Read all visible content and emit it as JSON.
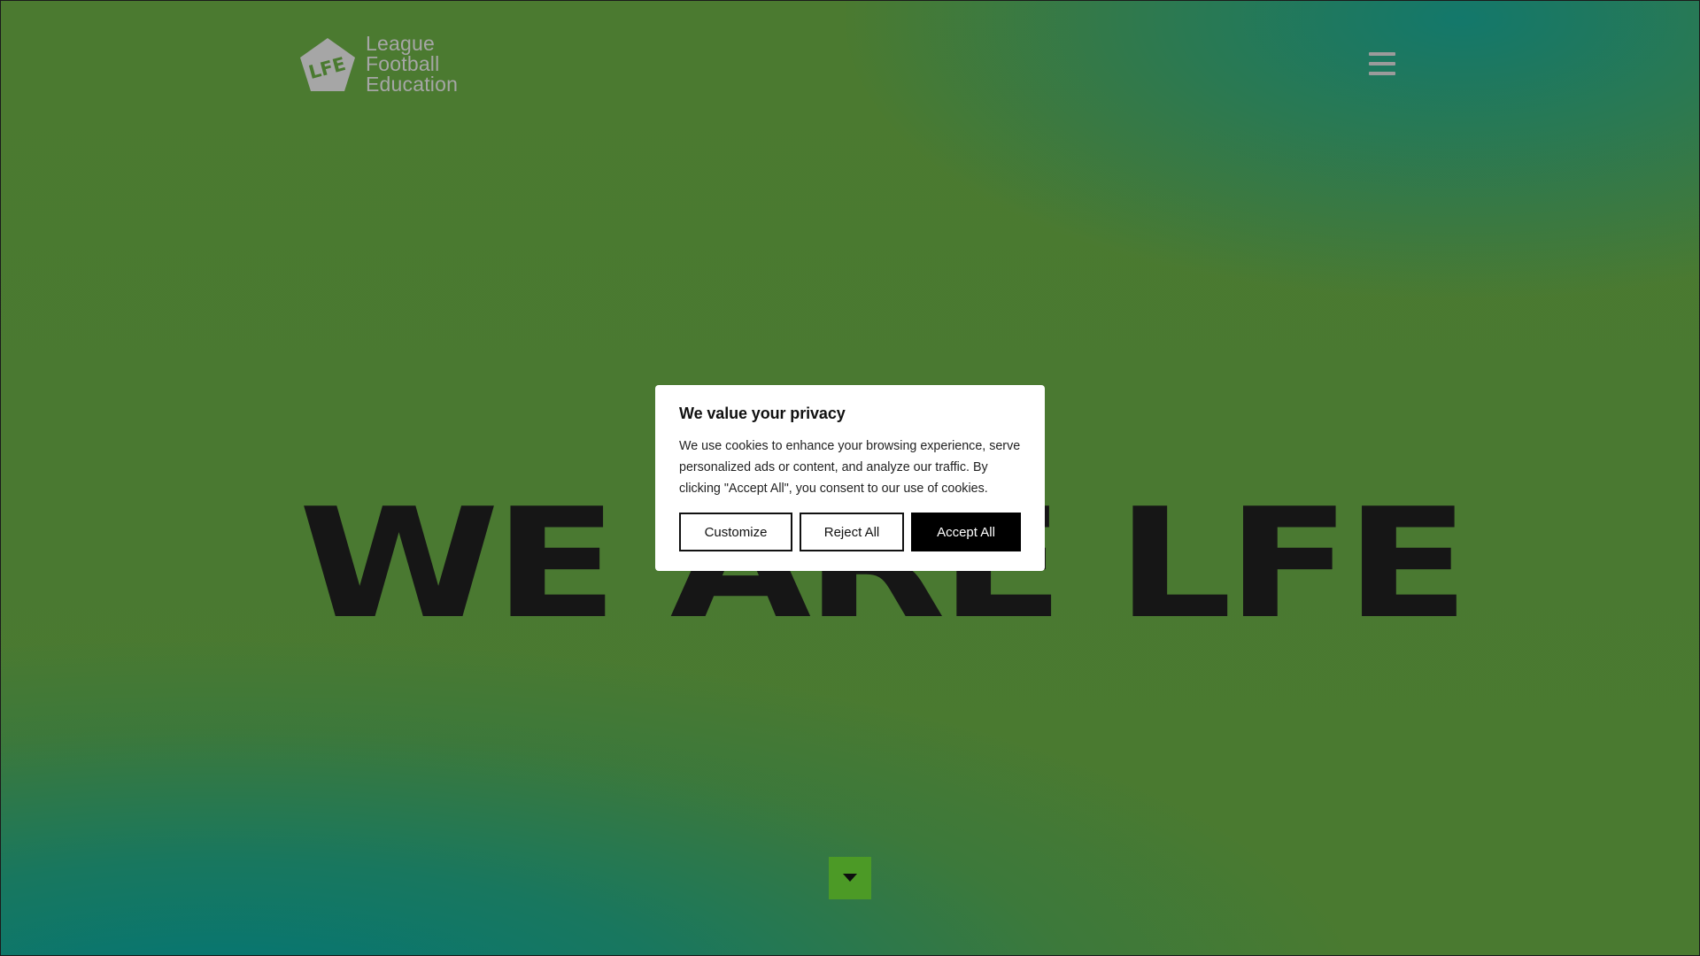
{
  "brand": {
    "logo_mark": "LFE",
    "logo_lines": [
      "League",
      "Football",
      "Education"
    ]
  },
  "header": {
    "menu_icon": "hamburger-menu-icon"
  },
  "hero": {
    "headline": "WE ARE LFE"
  },
  "cookie_banner": {
    "title": "We value your privacy",
    "body": "We use cookies to enhance your browsing experience, serve personalized ads or content, and analyze our traffic. By clicking \"Accept All\", you consent to our use of cookies.",
    "customize_label": "Customize",
    "reject_label": "Reject All",
    "accept_label": "Accept All"
  },
  "scroll_down": {
    "icon": "caret-down-icon"
  },
  "colors": {
    "background_green": "#4a7a30",
    "background_teal": "#0b7a73",
    "logo_grey": "#a6a6a6",
    "headline": "#161616",
    "scroll_button": "#4c9a26",
    "accept_button": "#000000"
  }
}
